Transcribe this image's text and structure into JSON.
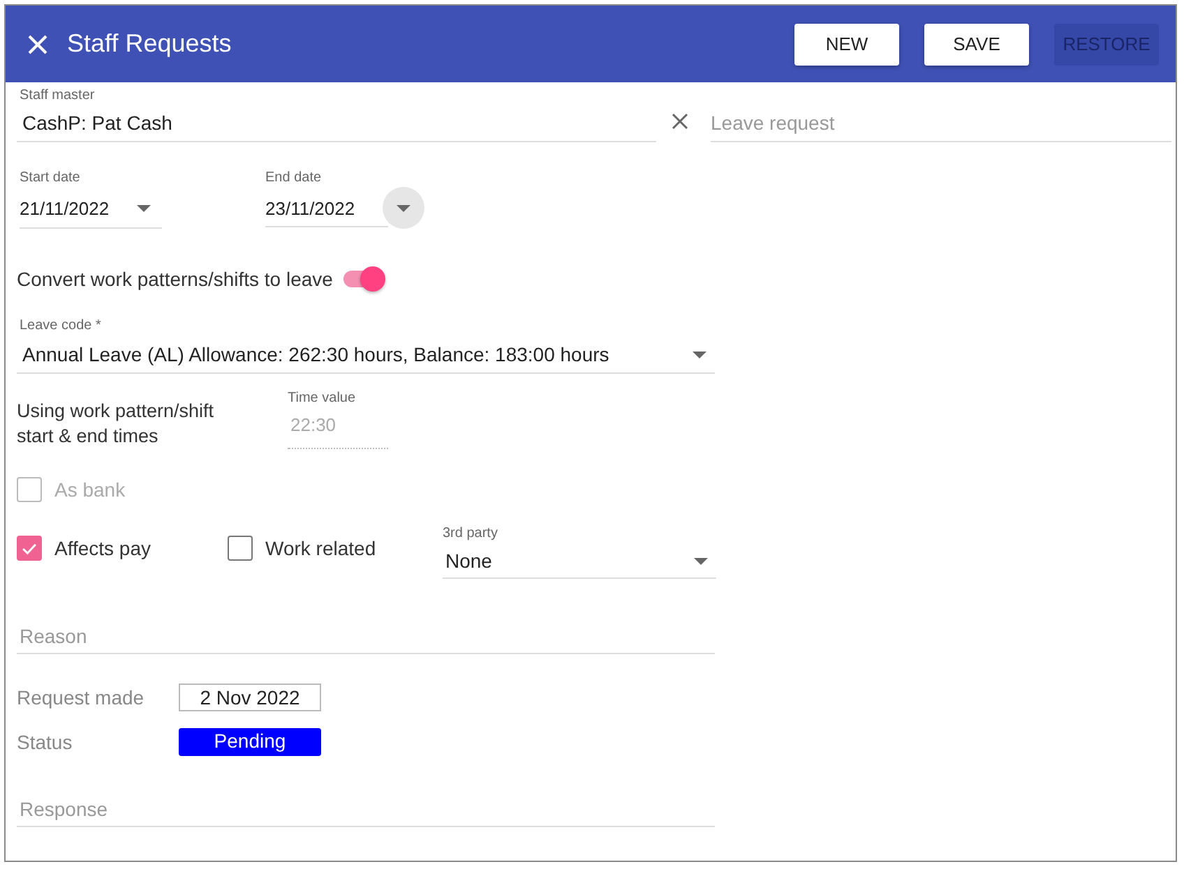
{
  "header": {
    "title": "Staff Requests",
    "buttons": [
      {
        "label": "NEW",
        "disabled": false
      },
      {
        "label": "SAVE",
        "disabled": false
      },
      {
        "label": "RESTORE",
        "disabled": true
      }
    ]
  },
  "staff_master": {
    "label": "Staff master",
    "value": "CashP: Pat Cash"
  },
  "leave_request": {
    "placeholder": "Leave request"
  },
  "dates": [
    {
      "label": "Start date",
      "value": "21/11/2022",
      "hovered": false
    },
    {
      "label": "End date",
      "value": "23/11/2022",
      "hovered": true
    }
  ],
  "convert": {
    "label": "Convert work patterns/shifts to leave",
    "on": true
  },
  "leave_code": {
    "label": "Leave code *",
    "value": "Annual Leave (AL) Allowance: 262:30 hours, Balance: 183:00 hours"
  },
  "time": {
    "note": "Using work pattern/shift start & end times",
    "label": "Time value",
    "value": "22:30",
    "disabled": true
  },
  "as_bank": {
    "label": "As bank",
    "checked": false,
    "disabled": true
  },
  "checkboxes": [
    {
      "label": "Affects pay",
      "checked": true,
      "disabled": false
    },
    {
      "label": "Work related",
      "checked": false,
      "disabled": false
    }
  ],
  "third_party": {
    "label": "3rd party",
    "value": "None"
  },
  "reason": {
    "placeholder": "Reason"
  },
  "request_made": {
    "label": "Request made",
    "value": "2 Nov 2022"
  },
  "status": {
    "label": "Status",
    "value": "Pending"
  },
  "response": {
    "placeholder": "Response"
  }
}
